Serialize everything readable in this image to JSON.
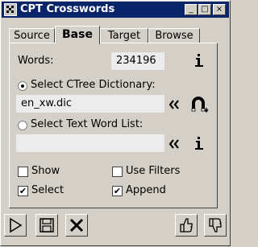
{
  "window": {
    "title": "CPT Crosswords"
  },
  "title_buttons": {
    "minimize": "_",
    "maximize": "□",
    "close": "×"
  },
  "tabs": [
    {
      "label": "Source"
    },
    {
      "label": "Base"
    },
    {
      "label": "Target"
    },
    {
      "label": "Browse"
    }
  ],
  "active_tab": "Base",
  "base": {
    "words_label": "Words:",
    "words_value": "234196",
    "ctree_option_label": "Select CTree Dictionary:",
    "ctree_value": "en_xw.dic",
    "textlist_option_label": "Select Text Word List:",
    "textlist_value": "",
    "show_label": "Show",
    "use_filters_label": "Use Filters",
    "select_label": "Select",
    "append_label": "Append",
    "show_checked": false,
    "use_filters_checked": false,
    "select_checked": true,
    "append_checked": true,
    "selected_source": "ctree"
  },
  "icons": {
    "info": "info-icon",
    "back": "double-chevron-left-icon",
    "magnet": "magnet-icon",
    "play": "play-icon",
    "save": "floppy-disk-icon",
    "cancel": "x-icon",
    "thumbs_up": "thumbs-up-icon",
    "thumbs_down": "thumbs-down-icon"
  },
  "colors": {
    "titlebar": "#0a246a",
    "face": "#d4d0c8",
    "field": "#ececec"
  }
}
